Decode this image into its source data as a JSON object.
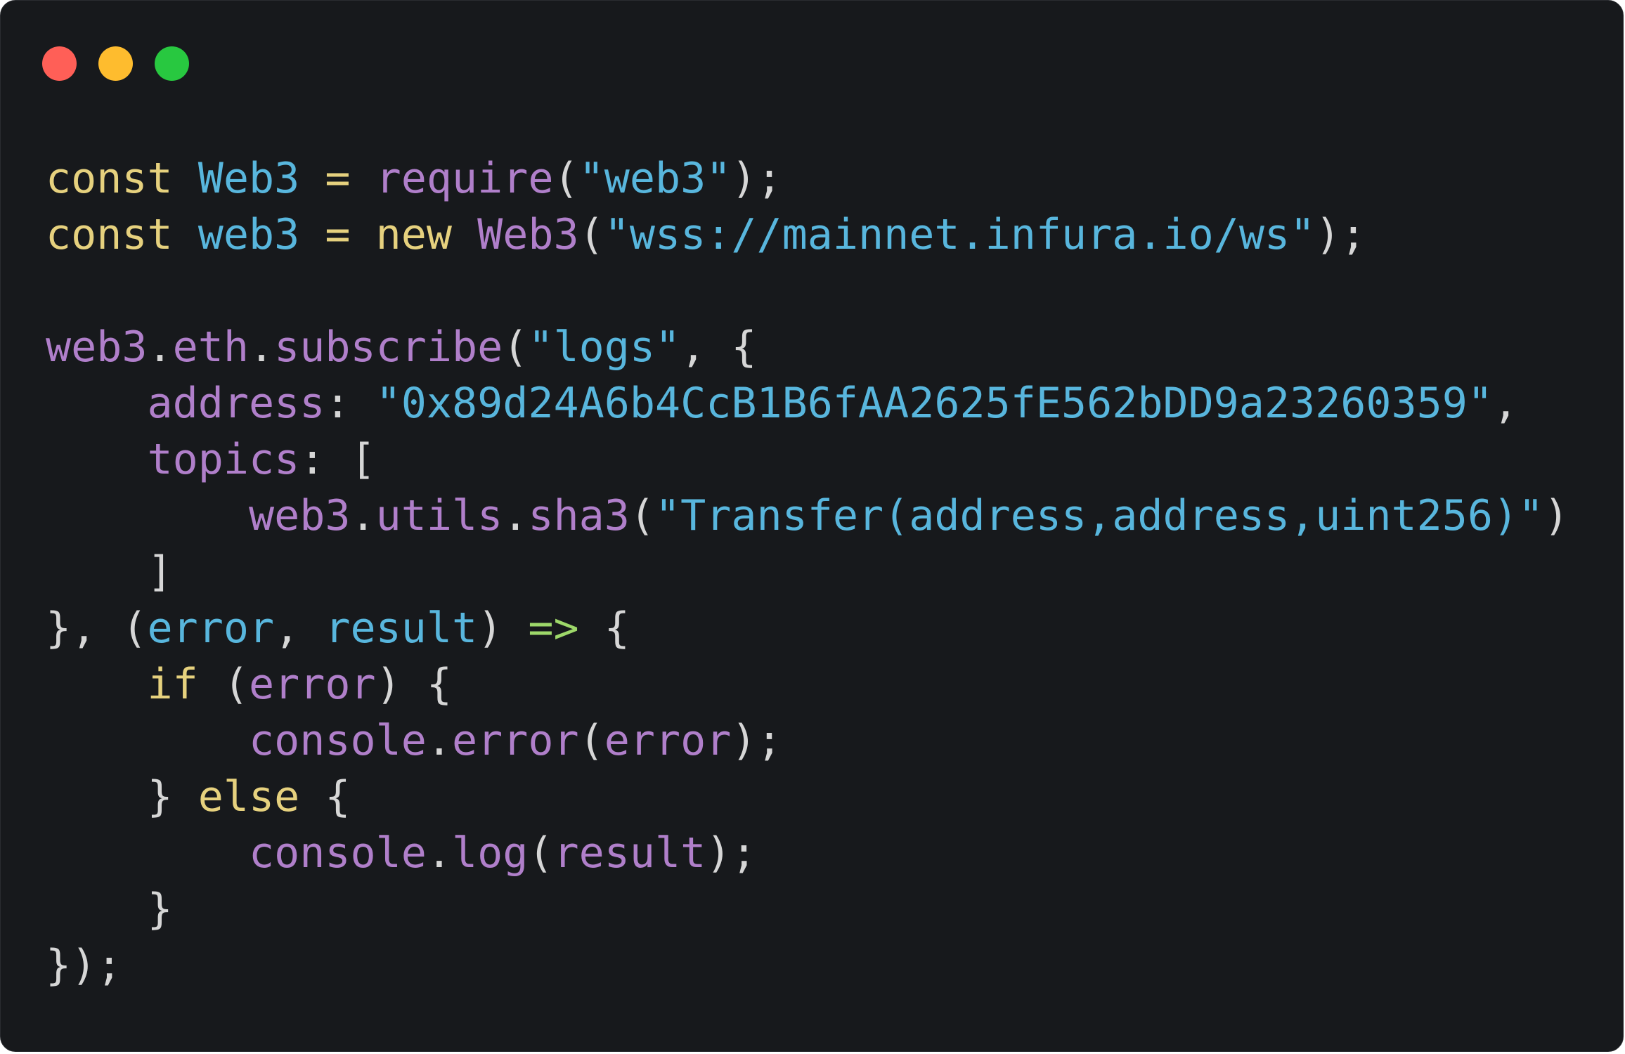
{
  "window": {
    "controls": {
      "close_color": "#ff5f57",
      "minimize_color": "#febc2e",
      "zoom_color": "#28c840"
    }
  },
  "colors": {
    "keyword": "#e6d17e",
    "variable": "#58b6dd",
    "function": "#b07fca",
    "string": "#58b6dd",
    "punct": "#d6d6d6",
    "operator": "#e6d17e",
    "arrow": "#9ed86a"
  },
  "code": {
    "lines": [
      [
        [
          "keyword",
          "const"
        ],
        [
          "punct",
          " "
        ],
        [
          "variable",
          "Web3"
        ],
        [
          "punct",
          " "
        ],
        [
          "operator",
          "="
        ],
        [
          "punct",
          " "
        ],
        [
          "function",
          "require"
        ],
        [
          "punct",
          "("
        ],
        [
          "string",
          "\"web3\""
        ],
        [
          "punct",
          ");"
        ]
      ],
      [
        [
          "keyword",
          "const"
        ],
        [
          "punct",
          " "
        ],
        [
          "variable",
          "web3"
        ],
        [
          "punct",
          " "
        ],
        [
          "operator",
          "="
        ],
        [
          "punct",
          " "
        ],
        [
          "keyword",
          "new"
        ],
        [
          "punct",
          " "
        ],
        [
          "function",
          "Web3"
        ],
        [
          "punct",
          "("
        ],
        [
          "string",
          "\"wss://mainnet.infura.io/ws\""
        ],
        [
          "punct",
          ");"
        ]
      ],
      [],
      [
        [
          "function",
          "web3"
        ],
        [
          "punct",
          "."
        ],
        [
          "function",
          "eth"
        ],
        [
          "punct",
          "."
        ],
        [
          "function",
          "subscribe"
        ],
        [
          "punct",
          "("
        ],
        [
          "string",
          "\"logs\""
        ],
        [
          "punct",
          ", {"
        ]
      ],
      [
        [
          "punct",
          "    "
        ],
        [
          "function",
          "address"
        ],
        [
          "punct",
          ": "
        ],
        [
          "string",
          "\"0x89d24A6b4CcB1B6fAA2625fE562bDD9a23260359\""
        ],
        [
          "punct",
          ","
        ]
      ],
      [
        [
          "punct",
          "    "
        ],
        [
          "function",
          "topics"
        ],
        [
          "punct",
          ": ["
        ]
      ],
      [
        [
          "punct",
          "        "
        ],
        [
          "function",
          "web3"
        ],
        [
          "punct",
          "."
        ],
        [
          "function",
          "utils"
        ],
        [
          "punct",
          "."
        ],
        [
          "function",
          "sha3"
        ],
        [
          "punct",
          "("
        ],
        [
          "string",
          "\"Transfer(address,address,uint256)\""
        ],
        [
          "punct",
          ")"
        ]
      ],
      [
        [
          "punct",
          "    ]"
        ]
      ],
      [
        [
          "punct",
          "}, ("
        ],
        [
          "variable",
          "error"
        ],
        [
          "punct",
          ", "
        ],
        [
          "variable",
          "result"
        ],
        [
          "punct",
          ") "
        ],
        [
          "arrow",
          "=>"
        ],
        [
          "punct",
          " {"
        ]
      ],
      [
        [
          "punct",
          "    "
        ],
        [
          "keyword",
          "if"
        ],
        [
          "punct",
          " ("
        ],
        [
          "function",
          "error"
        ],
        [
          "punct",
          ") {"
        ]
      ],
      [
        [
          "punct",
          "        "
        ],
        [
          "function",
          "console"
        ],
        [
          "punct",
          "."
        ],
        [
          "function",
          "error"
        ],
        [
          "punct",
          "("
        ],
        [
          "function",
          "error"
        ],
        [
          "punct",
          ");"
        ]
      ],
      [
        [
          "punct",
          "    } "
        ],
        [
          "keyword",
          "else"
        ],
        [
          "punct",
          " {"
        ]
      ],
      [
        [
          "punct",
          "        "
        ],
        [
          "function",
          "console"
        ],
        [
          "punct",
          "."
        ],
        [
          "function",
          "log"
        ],
        [
          "punct",
          "("
        ],
        [
          "function",
          "result"
        ],
        [
          "punct",
          ");"
        ]
      ],
      [
        [
          "punct",
          "    }"
        ]
      ],
      [
        [
          "punct",
          "});"
        ]
      ]
    ]
  }
}
